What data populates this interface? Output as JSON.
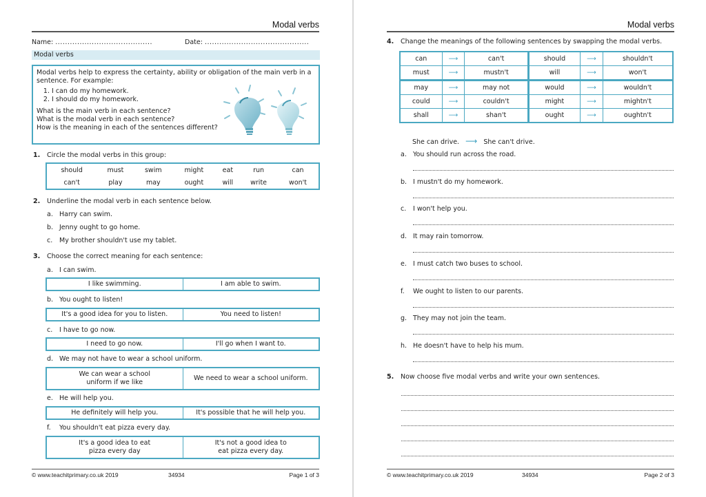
{
  "doc_title": "Modal verbs",
  "page1": {
    "header_title": "Modal verbs",
    "name_label": "Name:",
    "date_label": "Date:",
    "name_dots": "........................................",
    "date_dots": "...........................................",
    "section_title": "Modal verbs",
    "intro": {
      "paragraph": "Modal verbs help to express the certainty, ability or obligation of the main verb in a sentence. For example:",
      "examples": [
        "I can do my homework.",
        "I should do my homework."
      ],
      "questions": [
        "What is the main verb in each sentence?",
        "What is the modal verb in each sentence?",
        "How is the meaning in each of the sentences different?"
      ],
      "image": "lightbulbs-icon"
    },
    "q1": {
      "num": "1.",
      "text": "Circle the modal verbs in this group:",
      "rows": [
        [
          "should",
          "must",
          "swim",
          "might",
          "eat",
          "run",
          "can"
        ],
        [
          "can't",
          "play",
          "may",
          "ought",
          "will",
          "write",
          "won't"
        ]
      ]
    },
    "q2": {
      "num": "2.",
      "text": "Underline the modal verb in each sentence below.",
      "items": [
        {
          "label": "a.",
          "text": "Harry can swim."
        },
        {
          "label": "b.",
          "text": "Jenny ought to go home."
        },
        {
          "label": "c.",
          "text": "My brother shouldn't use my tablet."
        }
      ]
    },
    "q3": {
      "num": "3.",
      "text": "Choose the correct meaning for each sentence:",
      "items": [
        {
          "label": "a.",
          "text": "I can swim.",
          "options": [
            "I like swimming.",
            "I am able to swim."
          ]
        },
        {
          "label": "b.",
          "text": "You ought to listen!",
          "options": [
            "It's a good idea for you to listen.",
            "You need to listen!"
          ]
        },
        {
          "label": "c.",
          "text": "I have to go now.",
          "options": [
            "I need to go now.",
            "I'll go when I want to."
          ]
        },
        {
          "label": "d.",
          "text": "We may not have to wear a school uniform.",
          "options": [
            "We can wear a school uniform if we like",
            "We need to wear a school uniform."
          ]
        },
        {
          "label": "e.",
          "text": "He will help you.",
          "options": [
            "He definitely will help you.",
            "It's possible that he will help you."
          ]
        },
        {
          "label": "f.",
          "text": "You shouldn't eat pizza every day.",
          "options": [
            "It's a good idea to eat pizza every day",
            "It's not a good idea to eat pizza every day."
          ]
        }
      ]
    },
    "footer": {
      "copyright": "© www.teachitprimary.co.uk 2019",
      "code": "34934",
      "page": "Page 1 of 3"
    }
  },
  "page2": {
    "header_title": "Modal verbs",
    "q4": {
      "num": "4.",
      "text": "Change the meanings of the following sentences by swapping the modal verbs.",
      "pairs": [
        [
          [
            "can",
            "can't"
          ],
          [
            "should",
            "shouldn't"
          ]
        ],
        [
          [
            "must",
            "mustn't"
          ],
          [
            "will",
            "won't"
          ]
        ],
        [
          [
            "may",
            "may not"
          ],
          [
            "would",
            "wouldn't"
          ]
        ],
        [
          [
            "could",
            "couldn't"
          ],
          [
            "might",
            "mightn't"
          ]
        ],
        [
          [
            "shall",
            "shan't"
          ],
          [
            "ought",
            "oughtn't"
          ]
        ]
      ],
      "arrow_icon": "right-arrow-icon",
      "example_from": "She can drive.",
      "example_to": "She can't drive.",
      "items": [
        {
          "label": "a.",
          "text": "You should run across the road."
        },
        {
          "label": "b.",
          "text": "I mustn't do my homework."
        },
        {
          "label": "c.",
          "text": "I won't help you."
        },
        {
          "label": "d.",
          "text": "It may rain tomorrow."
        },
        {
          "label": "e.",
          "text": "I must catch two buses to school."
        },
        {
          "label": "f.",
          "text": "We ought to listen to our parents."
        },
        {
          "label": "g.",
          "text": "They may not join the team."
        },
        {
          "label": "h.",
          "text": "He doesn't have to help his mum."
        }
      ]
    },
    "q5": {
      "num": "5.",
      "text": "Now choose five modal verbs and write your own sentences.",
      "lines": 5
    },
    "footer": {
      "copyright": "© www.teachitprimary.co.uk 2019",
      "code": "34934",
      "page": "Page 2 of 3"
    }
  },
  "colors": {
    "accent": "#4aa8c2",
    "section_bar": "#d8ecf3",
    "arrow": "#3a9fc0"
  }
}
